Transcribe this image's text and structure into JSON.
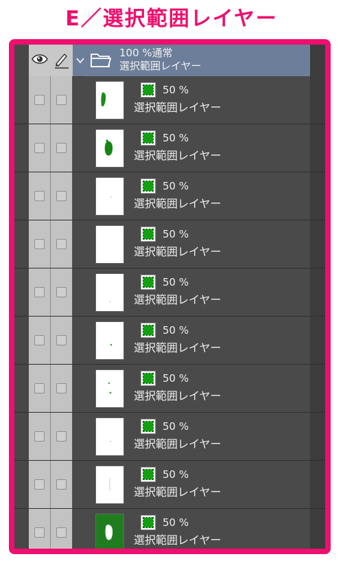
{
  "heading": "E／選択範囲レイヤー",
  "folder": {
    "opacity_blend": "100 %通常",
    "name": "選択範囲レイヤー"
  },
  "layers": [
    {
      "opacity": "50 %",
      "name": "選択範囲レイヤー",
      "thumb": "mark-left"
    },
    {
      "opacity": "50 %",
      "name": "選択範囲レイヤー",
      "thumb": "blob-center"
    },
    {
      "opacity": "50 %",
      "name": "選択範囲レイヤー",
      "thumb": "faint-dot"
    },
    {
      "opacity": "50 %",
      "name": "選択範囲レイヤー",
      "thumb": "blank"
    },
    {
      "opacity": "50 %",
      "name": "選択範囲レイヤー",
      "thumb": "faint-dot-low"
    },
    {
      "opacity": "50 %",
      "name": "選択範囲レイヤー",
      "thumb": "tiny-dot"
    },
    {
      "opacity": "50 %",
      "name": "選択範囲レイヤー",
      "thumb": "two-dots"
    },
    {
      "opacity": "50 %",
      "name": "選択範囲レイヤー",
      "thumb": "faint-dot"
    },
    {
      "opacity": "50 %",
      "name": "選択範囲レイヤー",
      "thumb": "faint-streak"
    },
    {
      "opacity": "50 %",
      "name": "選択範囲レイヤー",
      "thumb": "inverted"
    }
  ],
  "colors": {
    "accent": "#ee0f6e",
    "panel": "#4a4a4a",
    "folder_row": "#6d7e9a",
    "selection_green": "#12a012"
  },
  "icons": {
    "visibility": "eye-icon",
    "lock": "pen-icon",
    "folder": "folder-icon",
    "expand": "chevron-down-icon",
    "layer_type": "selection-layer-icon"
  }
}
